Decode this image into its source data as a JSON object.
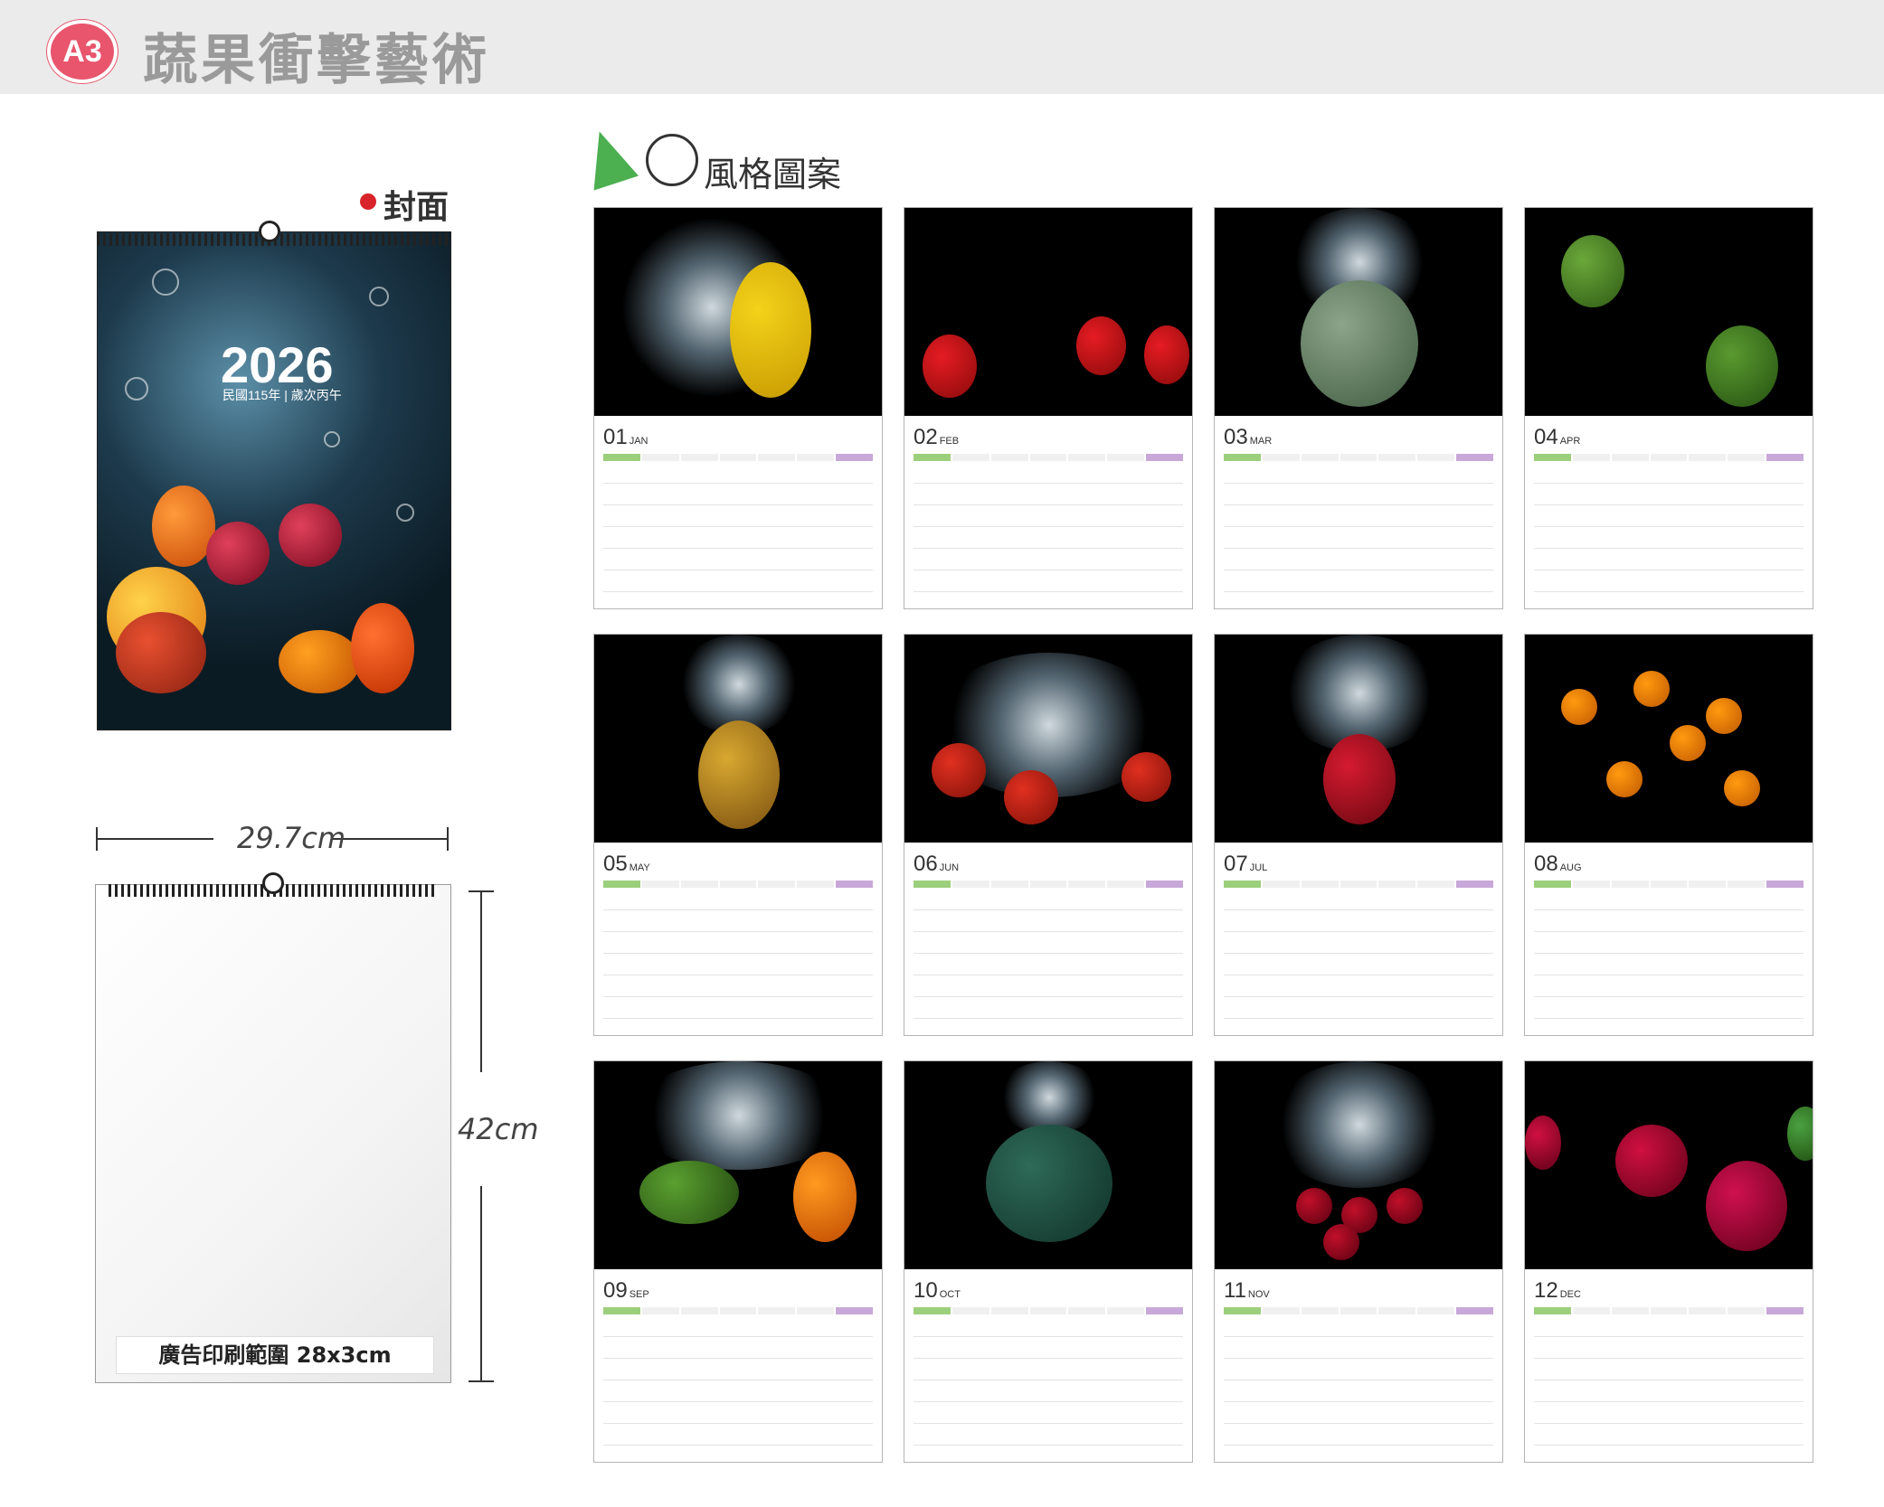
{
  "header": {
    "badge": "A3",
    "title": "蔬果衝擊藝術"
  },
  "cover": {
    "label": "封面",
    "year": "2026",
    "subtitle": "民國115年 | 歲次丙午"
  },
  "mockup": {
    "width_label": "29.7cm",
    "height_label": "42cm",
    "ad_area": "廣告印刷範圍 28x3cm"
  },
  "style_section": {
    "label": "風格圖案"
  },
  "months": [
    {
      "num": "01",
      "abbr": "JAN",
      "photo": "lemon-splash"
    },
    {
      "num": "02",
      "abbr": "FEB",
      "photo": "strawberries"
    },
    {
      "num": "03",
      "abbr": "MAR",
      "photo": "melon"
    },
    {
      "num": "04",
      "abbr": "APR",
      "photo": "bitter-gourd"
    },
    {
      "num": "05",
      "abbr": "MAY",
      "photo": "pineapple"
    },
    {
      "num": "06",
      "abbr": "JUN",
      "photo": "strawberry-tomato"
    },
    {
      "num": "07",
      "abbr": "JUL",
      "photo": "red-pepper"
    },
    {
      "num": "08",
      "abbr": "AUG",
      "photo": "kumquats"
    },
    {
      "num": "09",
      "abbr": "SEP",
      "photo": "gourd-pepper"
    },
    {
      "num": "10",
      "abbr": "OCT",
      "photo": "pumpkin"
    },
    {
      "num": "11",
      "abbr": "NOV",
      "photo": "cherries"
    },
    {
      "num": "12",
      "abbr": "DEC",
      "photo": "radishes"
    }
  ],
  "colors": {
    "badge": "#e8556d",
    "sunday": "#9ccf7c",
    "saturday": "#c8a8d8",
    "holiday": "#d8232a"
  }
}
